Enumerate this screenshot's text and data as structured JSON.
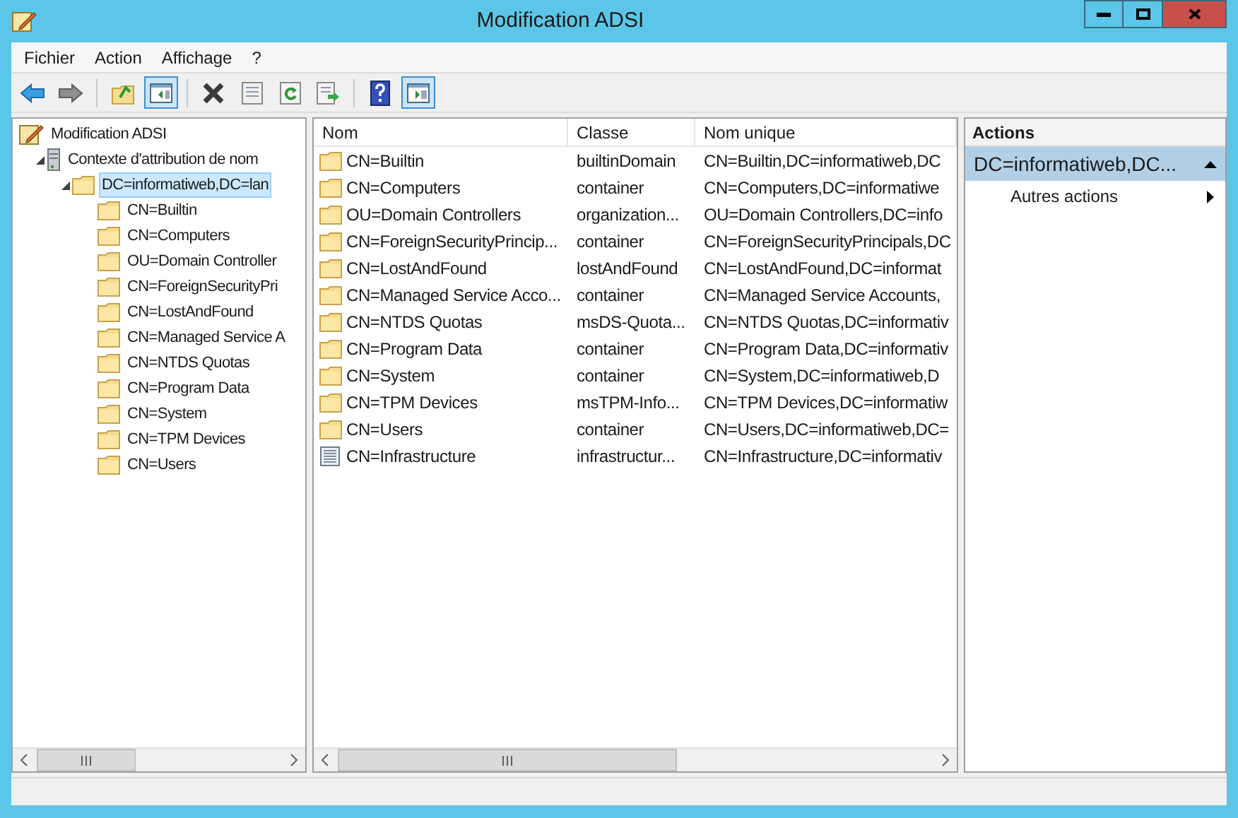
{
  "window": {
    "title": "Modification ADSI"
  },
  "menu": [
    "Fichier",
    "Action",
    "Affichage",
    "?"
  ],
  "toolbar": [
    {
      "kind": "back",
      "pressed": false
    },
    {
      "kind": "forward",
      "pressed": false
    },
    {
      "kind": "sep"
    },
    {
      "kind": "up",
      "pressed": false
    },
    {
      "kind": "tree",
      "pressed": true
    },
    {
      "kind": "sep"
    },
    {
      "kind": "delete",
      "pressed": false
    },
    {
      "kind": "properties",
      "pressed": false
    },
    {
      "kind": "refresh",
      "pressed": false
    },
    {
      "kind": "export",
      "pressed": false
    },
    {
      "kind": "sep"
    },
    {
      "kind": "help",
      "pressed": false
    },
    {
      "kind": "pane",
      "pressed": true
    }
  ],
  "tree": {
    "label": "Modification ADSI",
    "kind": "root",
    "selected": false,
    "children": [
      {
        "label": "Contexte d'attribution de nom",
        "kind": "server",
        "expanded": true,
        "selected": false,
        "children": [
          {
            "label": "DC=informatiweb,DC=lan",
            "kind": "folder",
            "expanded": true,
            "selected": true,
            "children": [
              {
                "label": "CN=Builtin",
                "kind": "folder",
                "selected": false
              },
              {
                "label": "CN=Computers",
                "kind": "folder",
                "selected": false
              },
              {
                "label": "OU=Domain Controller",
                "kind": "folder",
                "selected": false
              },
              {
                "label": "CN=ForeignSecurityPri",
                "kind": "folder",
                "selected": false
              },
              {
                "label": "CN=LostAndFound",
                "kind": "folder",
                "selected": false
              },
              {
                "label": "CN=Managed Service A",
                "kind": "folder",
                "selected": false
              },
              {
                "label": "CN=NTDS Quotas",
                "kind": "folder",
                "selected": false
              },
              {
                "label": "CN=Program Data",
                "kind": "folder",
                "selected": false
              },
              {
                "label": "CN=System",
                "kind": "folder",
                "selected": false
              },
              {
                "label": "CN=TPM Devices",
                "kind": "folder",
                "selected": false
              },
              {
                "label": "CN=Users",
                "kind": "folder",
                "selected": false
              }
            ]
          }
        ]
      }
    ]
  },
  "table": {
    "columns": [
      "Nom",
      "Classe",
      "Nom unique"
    ],
    "rows": [
      {
        "kind": "folder",
        "cells": [
          "CN=Builtin",
          "builtinDomain",
          "CN=Builtin,DC=informatiweb,DC"
        ]
      },
      {
        "kind": "folder",
        "cells": [
          "CN=Computers",
          "container",
          "CN=Computers,DC=informatiwe"
        ]
      },
      {
        "kind": "folder",
        "cells": [
          "OU=Domain Controllers",
          "organization...",
          "OU=Domain Controllers,DC=info"
        ]
      },
      {
        "kind": "folder",
        "cells": [
          "CN=ForeignSecurityPrincip...",
          "container",
          "CN=ForeignSecurityPrincipals,DC"
        ]
      },
      {
        "kind": "folder",
        "cells": [
          "CN=LostAndFound",
          "lostAndFound",
          "CN=LostAndFound,DC=informat"
        ]
      },
      {
        "kind": "folder",
        "cells": [
          "CN=Managed Service Acco...",
          "container",
          "CN=Managed Service Accounts,"
        ]
      },
      {
        "kind": "folder",
        "cells": [
          "CN=NTDS Quotas",
          "msDS-Quota...",
          "CN=NTDS Quotas,DC=informativ"
        ]
      },
      {
        "kind": "folder",
        "cells": [
          "CN=Program Data",
          "container",
          "CN=Program Data,DC=informativ"
        ]
      },
      {
        "kind": "folder",
        "cells": [
          "CN=System",
          "container",
          "CN=System,DC=informatiweb,D"
        ]
      },
      {
        "kind": "folder",
        "cells": [
          "CN=TPM Devices",
          "msTPM-Info...",
          "CN=TPM Devices,DC=informatiw"
        ]
      },
      {
        "kind": "folder",
        "cells": [
          "CN=Users",
          "container",
          "CN=Users,DC=informatiweb,DC="
        ]
      },
      {
        "kind": "object",
        "cells": [
          "CN=Infrastructure",
          "infrastructur...",
          "CN=Infrastructure,DC=informativ"
        ]
      }
    ]
  },
  "actions": {
    "title": "Actions",
    "section": {
      "label": "DC=informatiweb,DC...",
      "expanded": true
    },
    "items": [
      "Autres actions"
    ]
  }
}
